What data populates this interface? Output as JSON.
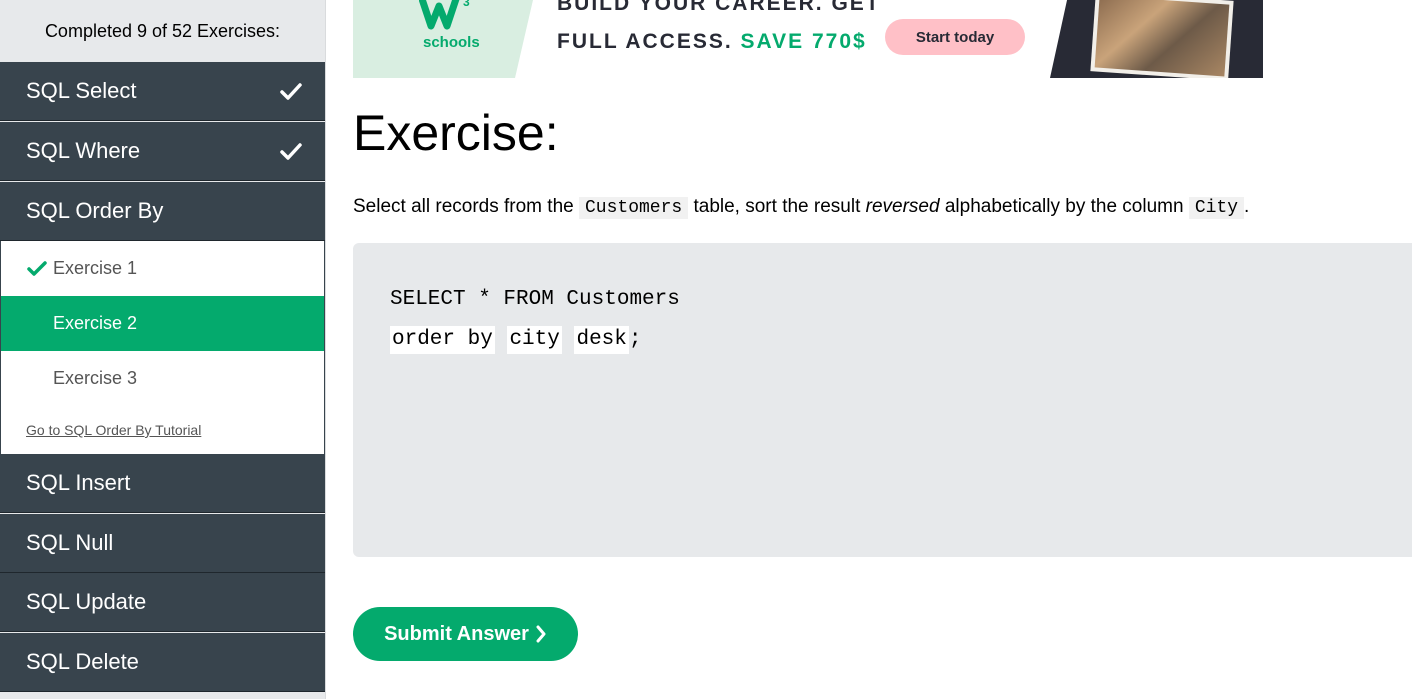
{
  "sidebar": {
    "progress_text": "Completed 9 of 52 Exercises:",
    "categories_top": [
      {
        "label": "SQL Select",
        "completed": true
      },
      {
        "label": "SQL Where",
        "completed": true
      },
      {
        "label": "SQL Order By",
        "completed": false
      }
    ],
    "exercises": [
      {
        "label": "Exercise 1",
        "completed": true,
        "active": false
      },
      {
        "label": "Exercise 2",
        "completed": false,
        "active": true
      },
      {
        "label": "Exercise 3",
        "completed": false,
        "active": false
      }
    ],
    "tutorial_link": "Go to SQL Order By Tutorial",
    "categories_bottom": [
      {
        "label": "SQL Insert"
      },
      {
        "label": "SQL Null"
      },
      {
        "label": "SQL Update"
      },
      {
        "label": "SQL Delete"
      }
    ]
  },
  "ad": {
    "logo_text": "schools",
    "line1": "BUILD YOUR CAREER. GET",
    "line2_prefix": "FULL ACCESS.",
    "line2_highlight": "SAVE 770$",
    "cta_label": "Start today"
  },
  "main": {
    "title": "Exercise:",
    "instruction": {
      "part1": "Select all records from the",
      "code1": "Customers",
      "part2": "table, sort the result",
      "emphasis": "reversed",
      "part3": "alphabetically by the column",
      "code2": "City",
      "part4": "."
    },
    "code": {
      "line1": "SELECT * FROM Customers",
      "inputs": [
        "order by",
        "city",
        "desk"
      ],
      "terminator": ";"
    },
    "submit_label": "Submit Answer",
    "submit_icon": "chevron-right-icon"
  },
  "colors": {
    "sidebar_dark": "#38444d",
    "accent_green": "#04aa6d",
    "editor_bg": "#e7e9eb"
  }
}
